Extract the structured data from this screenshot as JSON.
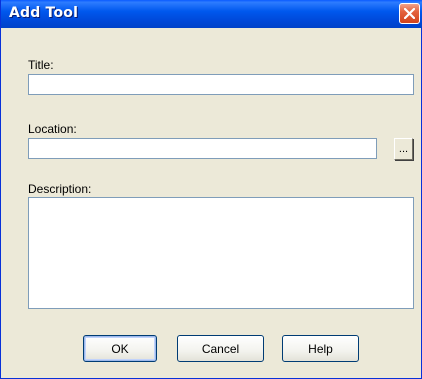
{
  "window": {
    "title": "Add Tool"
  },
  "form": {
    "title_label": "Title:",
    "title_value": "",
    "location_label": "Location:",
    "location_value": "",
    "browse_label": "...",
    "description_label": "Description:",
    "description_value": ""
  },
  "buttons": {
    "ok": "OK",
    "cancel": "Cancel",
    "help": "Help"
  },
  "icons": {
    "close": "close-icon"
  },
  "colors": {
    "titlebar": "#0054e3",
    "dialog_bg": "#ece9d8",
    "close_button": "#e4623d",
    "field_border": "#7f9db9",
    "button_border": "#003c74"
  }
}
